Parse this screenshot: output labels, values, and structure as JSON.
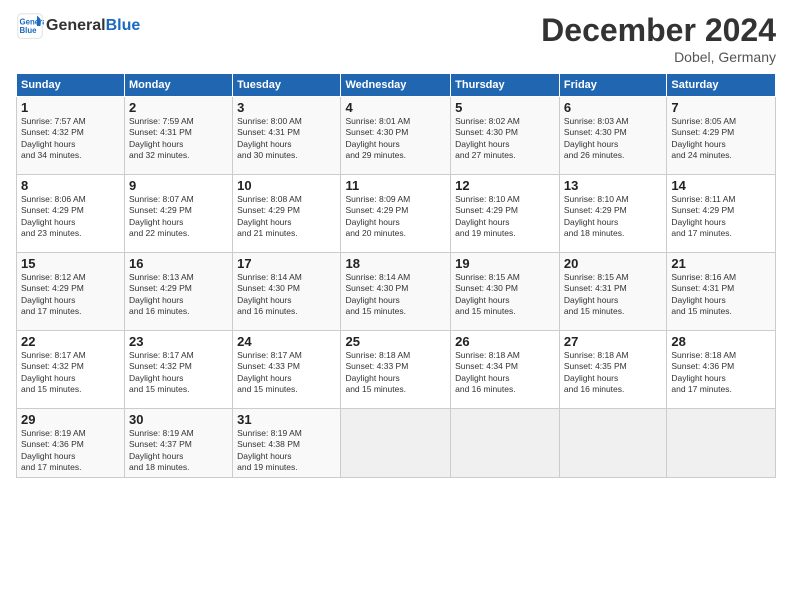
{
  "header": {
    "logo_line1": "General",
    "logo_line2": "Blue",
    "month": "December 2024",
    "location": "Dobel, Germany"
  },
  "weekdays": [
    "Sunday",
    "Monday",
    "Tuesday",
    "Wednesday",
    "Thursday",
    "Friday",
    "Saturday"
  ],
  "weeks": [
    [
      {
        "day": "1",
        "sunrise": "7:57 AM",
        "sunset": "4:32 PM",
        "daylight": "8 hours and 34 minutes."
      },
      {
        "day": "2",
        "sunrise": "7:59 AM",
        "sunset": "4:31 PM",
        "daylight": "8 hours and 32 minutes."
      },
      {
        "day": "3",
        "sunrise": "8:00 AM",
        "sunset": "4:31 PM",
        "daylight": "8 hours and 30 minutes."
      },
      {
        "day": "4",
        "sunrise": "8:01 AM",
        "sunset": "4:30 PM",
        "daylight": "8 hours and 29 minutes."
      },
      {
        "day": "5",
        "sunrise": "8:02 AM",
        "sunset": "4:30 PM",
        "daylight": "8 hours and 27 minutes."
      },
      {
        "day": "6",
        "sunrise": "8:03 AM",
        "sunset": "4:30 PM",
        "daylight": "8 hours and 26 minutes."
      },
      {
        "day": "7",
        "sunrise": "8:05 AM",
        "sunset": "4:29 PM",
        "daylight": "8 hours and 24 minutes."
      }
    ],
    [
      {
        "day": "8",
        "sunrise": "8:06 AM",
        "sunset": "4:29 PM",
        "daylight": "8 hours and 23 minutes."
      },
      {
        "day": "9",
        "sunrise": "8:07 AM",
        "sunset": "4:29 PM",
        "daylight": "8 hours and 22 minutes."
      },
      {
        "day": "10",
        "sunrise": "8:08 AM",
        "sunset": "4:29 PM",
        "daylight": "8 hours and 21 minutes."
      },
      {
        "day": "11",
        "sunrise": "8:09 AM",
        "sunset": "4:29 PM",
        "daylight": "8 hours and 20 minutes."
      },
      {
        "day": "12",
        "sunrise": "8:10 AM",
        "sunset": "4:29 PM",
        "daylight": "8 hours and 19 minutes."
      },
      {
        "day": "13",
        "sunrise": "8:10 AM",
        "sunset": "4:29 PM",
        "daylight": "8 hours and 18 minutes."
      },
      {
        "day": "14",
        "sunrise": "8:11 AM",
        "sunset": "4:29 PM",
        "daylight": "8 hours and 17 minutes."
      }
    ],
    [
      {
        "day": "15",
        "sunrise": "8:12 AM",
        "sunset": "4:29 PM",
        "daylight": "8 hours and 17 minutes."
      },
      {
        "day": "16",
        "sunrise": "8:13 AM",
        "sunset": "4:29 PM",
        "daylight": "8 hours and 16 minutes."
      },
      {
        "day": "17",
        "sunrise": "8:14 AM",
        "sunset": "4:30 PM",
        "daylight": "8 hours and 16 minutes."
      },
      {
        "day": "18",
        "sunrise": "8:14 AM",
        "sunset": "4:30 PM",
        "daylight": "8 hours and 15 minutes."
      },
      {
        "day": "19",
        "sunrise": "8:15 AM",
        "sunset": "4:30 PM",
        "daylight": "8 hours and 15 minutes."
      },
      {
        "day": "20",
        "sunrise": "8:15 AM",
        "sunset": "4:31 PM",
        "daylight": "8 hours and 15 minutes."
      },
      {
        "day": "21",
        "sunrise": "8:16 AM",
        "sunset": "4:31 PM",
        "daylight": "8 hours and 15 minutes."
      }
    ],
    [
      {
        "day": "22",
        "sunrise": "8:17 AM",
        "sunset": "4:32 PM",
        "daylight": "8 hours and 15 minutes."
      },
      {
        "day": "23",
        "sunrise": "8:17 AM",
        "sunset": "4:32 PM",
        "daylight": "8 hours and 15 minutes."
      },
      {
        "day": "24",
        "sunrise": "8:17 AM",
        "sunset": "4:33 PM",
        "daylight": "8 hours and 15 minutes."
      },
      {
        "day": "25",
        "sunrise": "8:18 AM",
        "sunset": "4:33 PM",
        "daylight": "8 hours and 15 minutes."
      },
      {
        "day": "26",
        "sunrise": "8:18 AM",
        "sunset": "4:34 PM",
        "daylight": "8 hours and 16 minutes."
      },
      {
        "day": "27",
        "sunrise": "8:18 AM",
        "sunset": "4:35 PM",
        "daylight": "8 hours and 16 minutes."
      },
      {
        "day": "28",
        "sunrise": "8:18 AM",
        "sunset": "4:36 PM",
        "daylight": "8 hours and 17 minutes."
      }
    ],
    [
      {
        "day": "29",
        "sunrise": "8:19 AM",
        "sunset": "4:36 PM",
        "daylight": "8 hours and 17 minutes."
      },
      {
        "day": "30",
        "sunrise": "8:19 AM",
        "sunset": "4:37 PM",
        "daylight": "8 hours and 18 minutes."
      },
      {
        "day": "31",
        "sunrise": "8:19 AM",
        "sunset": "4:38 PM",
        "daylight": "8 hours and 19 minutes."
      },
      null,
      null,
      null,
      null
    ]
  ]
}
